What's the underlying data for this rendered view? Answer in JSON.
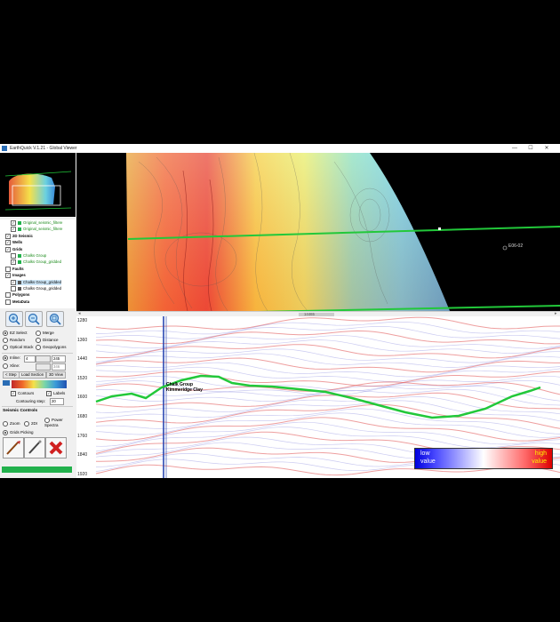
{
  "window": {
    "title": "EarthQuick V.1.21 - Global Viewer",
    "controls": {
      "minimize": "—",
      "maximize": "☐",
      "close": "✕"
    }
  },
  "tree": {
    "items": [
      {
        "label": "Original_seismic_filtere",
        "checked": true,
        "color": "green",
        "bold": false,
        "selected": false
      },
      {
        "label": "Original_seismic_filtere",
        "checked": true,
        "color": "green",
        "bold": false,
        "selected": false
      },
      {
        "label": "2D Seismic",
        "checked": true,
        "color": "black",
        "bold": true,
        "selected": false
      },
      {
        "label": "Wells",
        "checked": true,
        "color": "black",
        "bold": true,
        "selected": false
      },
      {
        "label": "Grids",
        "checked": true,
        "color": "black",
        "bold": true,
        "selected": false
      },
      {
        "label": "Chalks Group",
        "checked": false,
        "color": "green",
        "bold": false,
        "selected": false
      },
      {
        "label": "Chalks Group_gridded",
        "checked": true,
        "color": "green",
        "bold": false,
        "selected": false
      },
      {
        "label": "Faults",
        "checked": false,
        "color": "black",
        "bold": true,
        "selected": false
      },
      {
        "label": "Images",
        "checked": true,
        "color": "black",
        "bold": true,
        "selected": false
      },
      {
        "label": "Chalks Group_gridded",
        "checked": true,
        "color": "black",
        "bold": false,
        "selected": true
      },
      {
        "label": "Chalks Group_gridded",
        "checked": false,
        "color": "black",
        "bold": false,
        "selected": false
      },
      {
        "label": "Polygons",
        "checked": false,
        "color": "black",
        "bold": true,
        "selected": false
      },
      {
        "label": "MetaData",
        "checked": false,
        "color": "black",
        "bold": true,
        "selected": false
      }
    ]
  },
  "tools": {
    "radios": [
      {
        "label": "EZ Select",
        "on": true
      },
      {
        "label": "Merge",
        "on": false
      },
      {
        "label": "Random",
        "on": false
      },
      {
        "label": "Distance",
        "on": false
      },
      {
        "label": "Optical Stack",
        "on": false
      },
      {
        "label": "Geopolygons",
        "on": false
      }
    ],
    "inline_label": "Inline:",
    "inline_value": "245",
    "xline_label": "Xline:",
    "xline_value": "346",
    "step_value": "4",
    "tabs": [
      "< Step",
      "Load Section",
      "3D View"
    ],
    "contours_label": "Contours",
    "labels_label": "Labels",
    "contouring_step_label": "Contouring step:",
    "contouring_step_value": "20",
    "seismic_controls_label": "Seismic Controls",
    "seismic_radios": [
      {
        "label": "Zoom",
        "on": false
      },
      {
        "label": "2DI",
        "on": false
      },
      {
        "label": "Power Spectra",
        "on": false
      },
      {
        "label": "Grids Picking",
        "on": true
      }
    ]
  },
  "map": {
    "well_label": "E06-02",
    "scroll_label": "14465"
  },
  "seismic": {
    "y_ticks": [
      "1280",
      "1360",
      "1440",
      "1520",
      "1600",
      "1680",
      "1760",
      "1840",
      "1920"
    ],
    "horizon_label_1": "Chalk Group",
    "horizon_label_2": "Kimmeridge Clay",
    "legend": {
      "low": "low",
      "low_value": "value",
      "high": "high",
      "high_value": "value"
    }
  },
  "colors": {
    "horizon": "#22c83a",
    "well": "#1f3fae",
    "status_bar": "#22b14c",
    "legend_low": "#0000dd",
    "legend_high": "#dd0000"
  }
}
